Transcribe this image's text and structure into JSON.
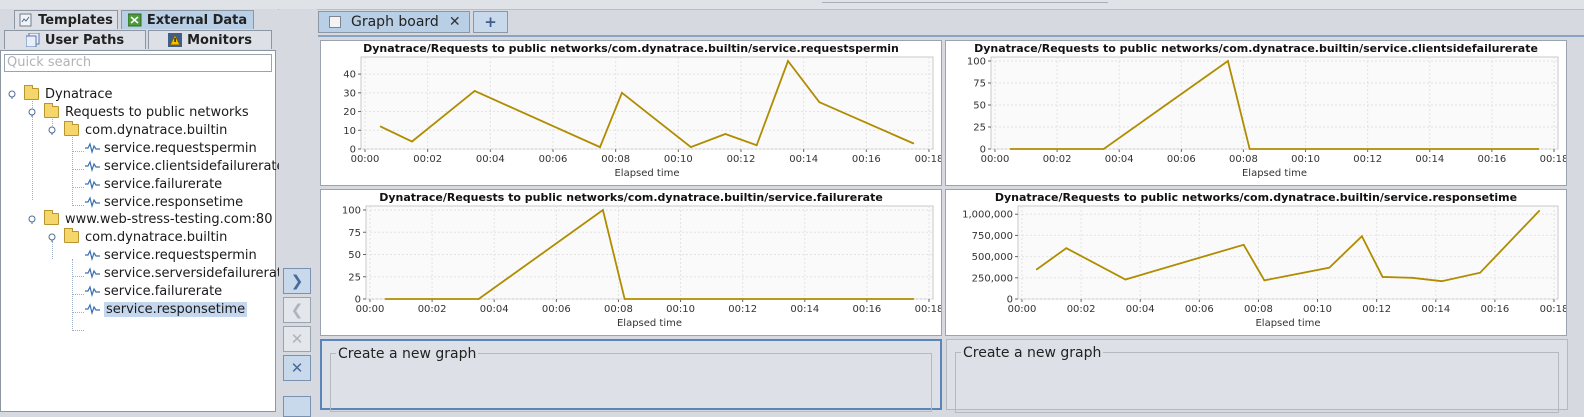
{
  "left_tabs": {
    "templates": "Templates",
    "external_data": "External Data",
    "user_paths": "User Paths",
    "monitors": "Monitors"
  },
  "search": {
    "placeholder": "Quick search"
  },
  "tree": {
    "root": "Dynatrace",
    "group1": "Requests to public networks",
    "group1_pkg": "com.dynatrace.builtin",
    "group1_items": [
      "service.requestspermin",
      "service.clientsidefailurerate",
      "service.failurerate",
      "service.responsetime"
    ],
    "group2": "www.web-stress-testing.com:80",
    "group2_pkg": "com.dynatrace.builtin",
    "group2_items": [
      "service.requestspermin",
      "service.serversidefailurerate",
      "service.failurerate",
      "service.responsetime"
    ]
  },
  "graph_tab": {
    "label": "Graph board",
    "close": "✕",
    "add": "+"
  },
  "new_graph_label": "Create a new graph",
  "colors": {
    "line": "#b08c00",
    "accent": "#b9cfe6"
  },
  "chart_data": [
    {
      "type": "line",
      "title": "Dynatrace/Requests to public networks/com.dynatrace.builtin/service.requestspermin",
      "xlabel": "Elapsed time",
      "x_ticks": [
        "00:00",
        "00:02",
        "00:04",
        "00:06",
        "00:08",
        "00:10",
        "00:12",
        "00:14",
        "00:16",
        "00:18"
      ],
      "x_range_min": [
        0,
        18
      ],
      "ylim": [
        0,
        47
      ],
      "y_ticks": [
        "0",
        "10",
        "20",
        "30",
        "40"
      ],
      "y_tick_values": [
        0,
        10,
        20,
        30,
        40
      ],
      "x_min": [
        0.5,
        1.5,
        3.5,
        7.5,
        8.2,
        10.4,
        11.5,
        12.5,
        13.5,
        14.5,
        17.5
      ],
      "y": [
        12,
        4,
        31,
        1,
        30,
        1,
        8,
        2,
        47,
        25,
        3
      ]
    },
    {
      "type": "line",
      "title": "Dynatrace/Requests to public networks/com.dynatrace.builtin/service.clientsidefailurerate",
      "xlabel": "Elapsed time",
      "x_ticks": [
        "00:00",
        "00:02",
        "00:04",
        "00:06",
        "00:08",
        "00:10",
        "00:12",
        "00:14",
        "00:16",
        "00:18"
      ],
      "x_range_min": [
        0,
        18
      ],
      "ylim": [
        0,
        100
      ],
      "y_ticks": [
        "0",
        "25",
        "50",
        "75",
        "100"
      ],
      "y_tick_values": [
        0,
        25,
        50,
        75,
        100
      ],
      "x_min": [
        0.5,
        3.5,
        7.5,
        8.2,
        17.5
      ],
      "y": [
        0,
        0,
        100,
        0,
        0
      ]
    },
    {
      "type": "line",
      "title": "Dynatrace/Requests to public networks/com.dynatrace.builtin/service.failurerate",
      "xlabel": "Elapsed time",
      "x_ticks": [
        "00:00",
        "00:02",
        "00:04",
        "00:06",
        "00:08",
        "00:10",
        "00:12",
        "00:14",
        "00:16",
        "00:18"
      ],
      "x_range_min": [
        0,
        18
      ],
      "ylim": [
        0,
        100
      ],
      "y_ticks": [
        "0",
        "25",
        "50",
        "75",
        "100"
      ],
      "y_tick_values": [
        0,
        25,
        50,
        75,
        100
      ],
      "x_min": [
        0.5,
        3.5,
        7.5,
        8.2,
        17.5
      ],
      "y": [
        0,
        0,
        100,
        0,
        0
      ]
    },
    {
      "type": "line",
      "title": "Dynatrace/Requests to public networks/com.dynatrace.builtin/service.responsetime",
      "xlabel": "Elapsed time",
      "x_ticks": [
        "00:00",
        "00:02",
        "00:04",
        "00:06",
        "00:08",
        "00:10",
        "00:12",
        "00:14",
        "00:16",
        "00:18"
      ],
      "x_range_min": [
        0,
        18
      ],
      "ylim": [
        0,
        1050000
      ],
      "y_ticks": [
        "0",
        "250,000",
        "500,000",
        "750,000",
        "1,000,000"
      ],
      "y_tick_values": [
        0,
        250000,
        500000,
        750000,
        1000000
      ],
      "x_min": [
        0.5,
        1.5,
        3.5,
        7.5,
        8.2,
        10.4,
        11.5,
        12.2,
        13.2,
        14.2,
        15.5,
        17.5
      ],
      "y": [
        350000,
        600000,
        230000,
        640000,
        220000,
        370000,
        740000,
        260000,
        250000,
        210000,
        310000,
        1040000
      ]
    }
  ]
}
